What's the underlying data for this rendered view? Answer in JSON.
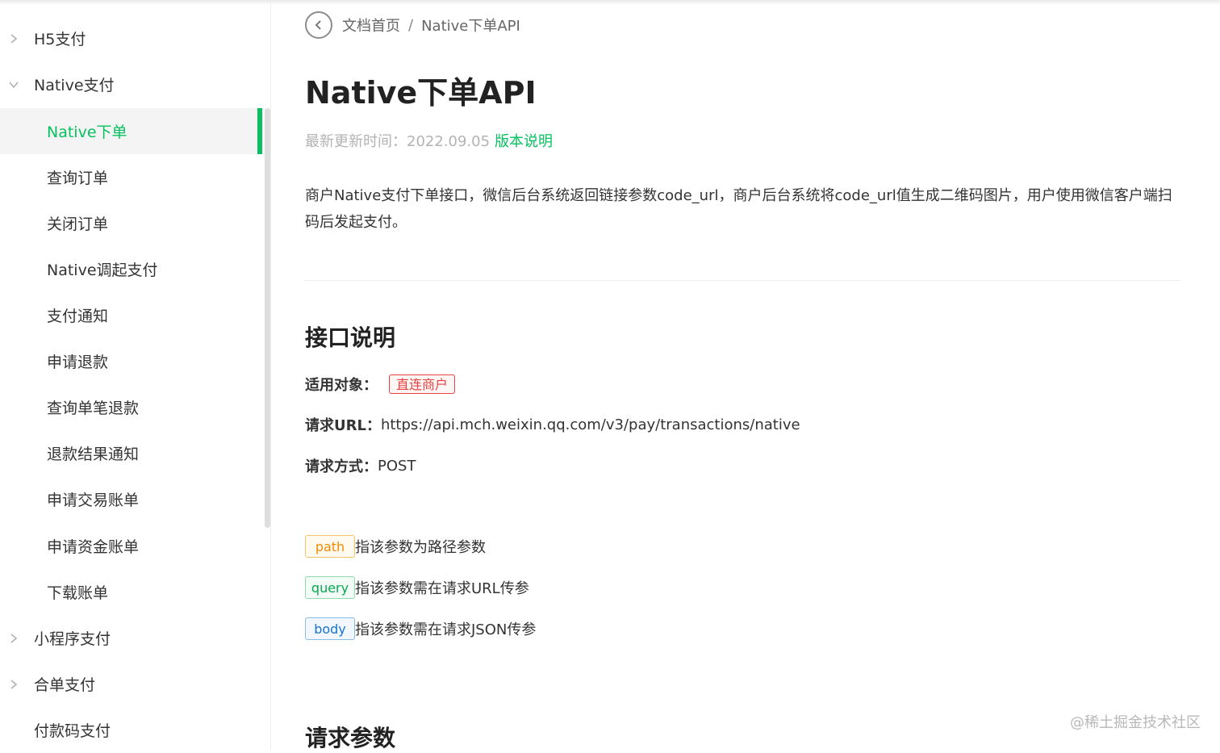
{
  "sidebar": {
    "items": [
      {
        "label": "H5支付",
        "level": 1,
        "expanded": false
      },
      {
        "label": "Native支付",
        "level": 1,
        "expanded": true
      },
      {
        "label": "Native下单",
        "level": 2,
        "active": true
      },
      {
        "label": "查询订单",
        "level": 2
      },
      {
        "label": "关闭订单",
        "level": 2
      },
      {
        "label": "Native调起支付",
        "level": 2
      },
      {
        "label": "支付通知",
        "level": 2
      },
      {
        "label": "申请退款",
        "level": 2
      },
      {
        "label": "查询单笔退款",
        "level": 2
      },
      {
        "label": "退款结果通知",
        "level": 2
      },
      {
        "label": "申请交易账单",
        "level": 2
      },
      {
        "label": "申请资金账单",
        "level": 2
      },
      {
        "label": "下载账单",
        "level": 2
      },
      {
        "label": "小程序支付",
        "level": 1,
        "expanded": false
      },
      {
        "label": "合单支付",
        "level": 1,
        "expanded": false
      },
      {
        "label": "付款码支付",
        "level": 1
      }
    ]
  },
  "breadcrumb": {
    "home": "文档首页",
    "separator": "/",
    "current": "Native下单API"
  },
  "page": {
    "title": "Native下单API",
    "updated_label": "最新更新时间：",
    "updated_date": "2022.09.05",
    "version_link": "版本说明",
    "description": "商户Native支付下单接口，微信后台系统返回链接参数code_url，商户后台系统将code_url值生成二维码图片，用户使用微信客户端扫码后发起支付。"
  },
  "api": {
    "section_title": "接口说明",
    "target_label": "适用对象：",
    "target_tag": "直连商户",
    "url_label": "请求URL：",
    "url_value": "https://api.mch.weixin.qq.com/v3/pay/transactions/native",
    "method_label": "请求方式：",
    "method_value": "POST"
  },
  "legend": [
    {
      "tag": "path",
      "text": "指该参数为路径参数"
    },
    {
      "tag": "query",
      "text": "指该参数需在请求URL传参"
    },
    {
      "tag": "body",
      "text": "指该参数需在请求JSON传参"
    }
  ],
  "params": {
    "section_title": "请求参数"
  },
  "watermark": "@稀土掘金技术社区",
  "colors": {
    "accent": "#07c160",
    "tag_red": "#e64340",
    "tag_orange": "#f08c00",
    "tag_blue": "#1a73c9"
  }
}
